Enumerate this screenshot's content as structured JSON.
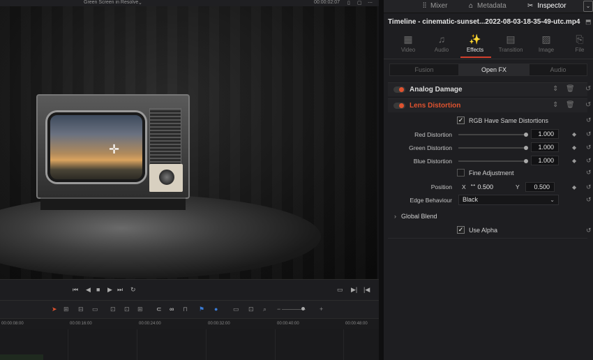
{
  "viewer": {
    "title": "Green Screen in Resolve",
    "title_chevron_icon": "chevron-down-icon",
    "timecode": "00:00:02:07",
    "transport_icons": [
      "skip-to-start-icon",
      "step-back-icon",
      "stop-icon",
      "play-icon",
      "skip-to-end-icon",
      "loop-icon"
    ],
    "right_icons": [
      "match-frame-icon",
      "next-edit-icon",
      "previous-edit-icon"
    ]
  },
  "timeline": {
    "ruler": [
      "00:00:08:00",
      "00:00:16:00",
      "00:00:24:00",
      "00:00:32:00",
      "00:00:40:00",
      "00:00:48:00"
    ],
    "toolbar_icons": [
      "selection-icon",
      "trim-icon",
      "dynamic-trim-icon",
      "blade-icon",
      "insert-icon",
      "overwrite-icon",
      "replace-icon",
      "snapping-icon",
      "linked-selection-icon",
      "lock-icon",
      "flag-icon",
      "marker-icon",
      "zoom-full-icon",
      "zoom-detail-icon",
      "zoom-custom-icon",
      "zoom-out-icon",
      "zoom-in-icon"
    ]
  },
  "top_tabs": {
    "mixer": "Mixer",
    "metadata": "Metadata",
    "inspector": "Inspector"
  },
  "timeline_name": "Timeline - cinematic-sunset...2022-08-03-18-35-49-utc.mp4",
  "category_tabs": [
    {
      "label": "Video",
      "icon": "video-icon",
      "active": false
    },
    {
      "label": "Audio",
      "icon": "audio-icon",
      "active": false
    },
    {
      "label": "Effects",
      "icon": "effects-icon",
      "active": true
    },
    {
      "label": "Transition",
      "icon": "transition-icon",
      "active": false
    },
    {
      "label": "Image",
      "icon": "image-icon",
      "active": false
    },
    {
      "label": "File",
      "icon": "file-icon",
      "active": false
    }
  ],
  "sub_tabs": [
    {
      "label": "Fusion",
      "active": false
    },
    {
      "label": "Open FX",
      "active": true
    },
    {
      "label": "Audio",
      "active": false
    }
  ],
  "effects": {
    "analog_damage": "Analog Damage",
    "lens_distortion": "Lens Distortion"
  },
  "lens": {
    "rgb_same": "RGB Have Same Distortions",
    "red_label": "Red Distortion",
    "red_value": "1.000",
    "green_label": "Green Distortion",
    "green_value": "1.000",
    "blue_label": "Blue Distortion",
    "blue_value": "1.000",
    "fine_adjust": "Fine Adjustment",
    "position_label": "Position",
    "x_label": "X",
    "x_value": "0.500",
    "y_label": "Y",
    "y_value": "0.500",
    "edge_label": "Edge Behaviour",
    "edge_value": "Black"
  },
  "global_blend": "Global Blend",
  "use_alpha": "Use Alpha",
  "colors": {
    "accent": "#e0532f",
    "panel": "#1e1e21"
  }
}
